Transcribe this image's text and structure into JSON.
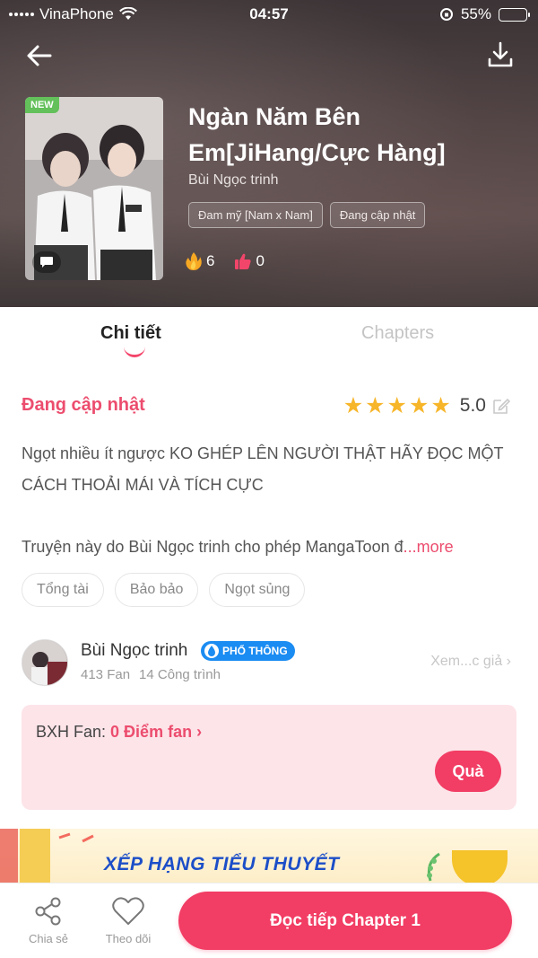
{
  "status_bar": {
    "carrier": "VinaPhone",
    "time": "04:57",
    "battery_percent": "55%",
    "battery_level": 0.55
  },
  "header": {
    "back_icon": "arrow-left-icon",
    "download_icon": "download-icon"
  },
  "comic": {
    "badge": "NEW",
    "title": "Ngàn Năm Bên Em[JiHang/Cực Hàng]",
    "author": "Bùi Ngọc trinh",
    "tags": [
      "Đam mỹ [Nam x Nam]",
      "Đang cập nhật"
    ],
    "fire_count": "6",
    "like_count": "0"
  },
  "tabs": [
    {
      "label": "Chi tiết",
      "active": true
    },
    {
      "label": "Chapters",
      "active": false
    }
  ],
  "detail": {
    "status": "Đang cập nhật",
    "rating_stars": 5,
    "rating_score": "5.0",
    "description": "Ngọt nhiều ít ngược KO GHÉP LÊN NGƯỜI THẬT HÃY ĐỌC MỘT CÁCH THOẢI MÁI VÀ TÍCH CỰC",
    "license_text": "Truyện này do Bùi Ngọc trinh cho phép MangaToon đ",
    "more_label": "...more",
    "genres": [
      "Tổng tài",
      "Bảo bảo",
      "Ngọt sủng"
    ]
  },
  "author_card": {
    "name": "Bùi Ngọc trinh",
    "rank": "PHỔ THÔNG",
    "fans": "413 Fan",
    "works": "14 Công trình",
    "see_author": "Xem...c giả ›"
  },
  "fan_ranking": {
    "label": "BXH Fan:",
    "points": "0 Điểm fan ›",
    "gift_button": "Quà"
  },
  "banner": {
    "text": "XẾP HẠNG TIỂU THUYẾT"
  },
  "bottom_bar": {
    "share_label": "Chia sẻ",
    "follow_label": "Theo dõi",
    "read_button": "Đọc tiếp Chapter 1"
  },
  "colors": {
    "accent": "#f23d64",
    "accent_text": "#ec4d6e",
    "star": "#f7b529",
    "rank_badge": "#1b8cf2",
    "new_badge": "#63c05a"
  }
}
